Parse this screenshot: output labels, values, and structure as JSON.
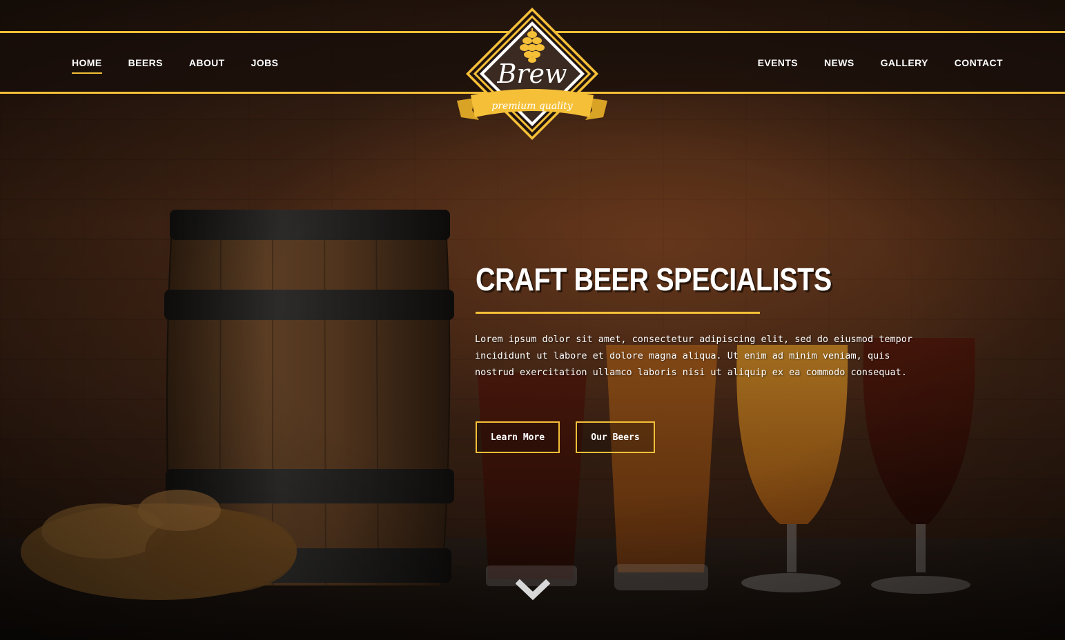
{
  "brand": {
    "name": "Brew",
    "tagline": "premium quality",
    "accent_color": "#f5c038"
  },
  "nav": {
    "left": [
      {
        "label": "HOME",
        "active": true
      },
      {
        "label": "BEERS"
      },
      {
        "label": "ABOUT"
      },
      {
        "label": "JOBS"
      }
    ],
    "right": [
      {
        "label": "EVENTS"
      },
      {
        "label": "NEWS"
      },
      {
        "label": "GALLERY"
      },
      {
        "label": "CONTACT"
      }
    ]
  },
  "hero": {
    "title": "CRAFT BEER SPECIALISTS",
    "body": "Lorem ipsum dolor sit amet, consectetur adipiscing elit, sed do eiusmod tempor incididunt ut labore et dolore magna aliqua. Ut enim ad minim veniam, quis nostrud exercitation ullamco laboris nisi ut aliquip ex ea commodo consequat.",
    "buttons": {
      "primary": "Learn More",
      "secondary": "Our Beers"
    },
    "scroll_icon": "chevron-down-icon"
  }
}
